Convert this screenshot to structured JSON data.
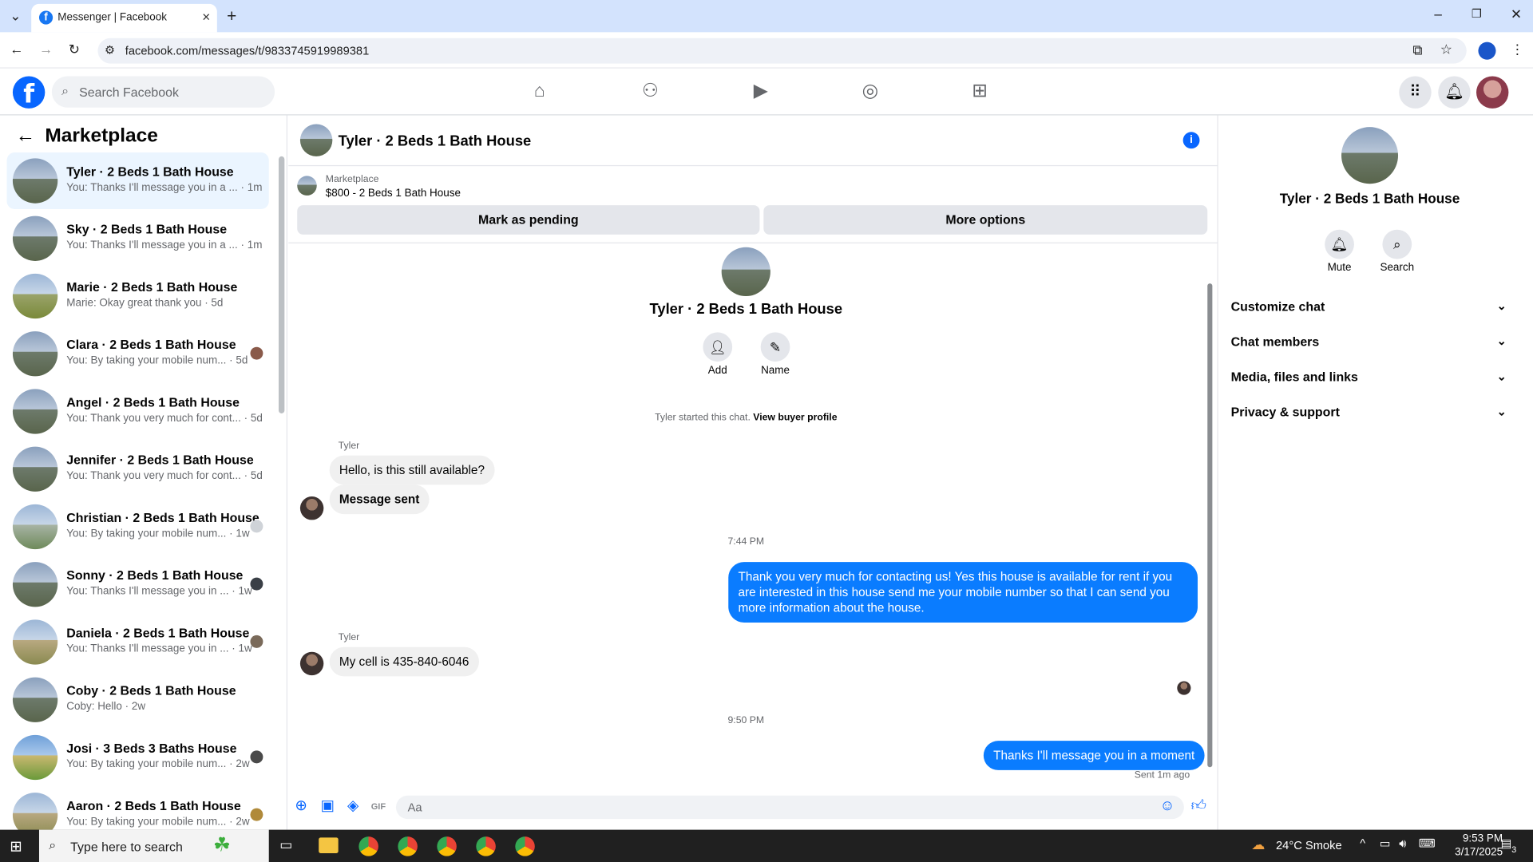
{
  "browser": {
    "tab_title": "Messenger | Facebook",
    "url": "facebook.com/messages/t/9833745919989381"
  },
  "fb": {
    "search_placeholder": "Search Facebook"
  },
  "left_panel": {
    "title": "Marketplace",
    "conversations": [
      {
        "name": "Tyler · 2 Beds 1 Bath House",
        "preview": "You: Thanks I'll message you in a ... · 1m"
      },
      {
        "name": "Sky · 2 Beds 1 Bath House",
        "preview": "You: Thanks I'll message you in a ... · 1m"
      },
      {
        "name": "Marie · 2 Beds 1 Bath House",
        "preview": "Marie: Okay great thank you · 5d"
      },
      {
        "name": "Clara · 2 Beds 1 Bath House",
        "preview": "You: By taking your mobile num... · 5d"
      },
      {
        "name": "Angel · 2 Beds 1 Bath House",
        "preview": "You: Thank you very much for cont... · 5d"
      },
      {
        "name": "Jennifer · 2 Beds 1 Bath House",
        "preview": "You: Thank you very much for cont... · 5d"
      },
      {
        "name": "Christian · 2 Beds 1 Bath House",
        "preview": "You: By taking your mobile num... · 1w"
      },
      {
        "name": "Sonny · 2 Beds 1 Bath House",
        "preview": "You: Thanks I'll message you in ... · 1w"
      },
      {
        "name": "Daniela · 2 Beds 1 Bath House",
        "preview": "You: Thanks I'll message you in ... · 1w"
      },
      {
        "name": "Coby · 2 Beds 1 Bath House",
        "preview": "Coby: Hello · 2w"
      },
      {
        "name": "Josi · 3 Beds 3 Baths House",
        "preview": "You: By taking your mobile num... · 2w"
      },
      {
        "name": "Aaron · 2 Beds 1 Bath House",
        "preview": "You: By taking your mobile num... · 2w"
      }
    ]
  },
  "chat": {
    "title": "Tyler · 2 Beds 1 Bath House",
    "marketplace_label": "Marketplace",
    "listing": "$800 - 2 Beds 1 Bath House",
    "mark_pending": "Mark as pending",
    "more_options": "More options",
    "profile_name": "Tyler · 2 Beds 1 Bath House",
    "add_label": "Add",
    "name_label": "Name",
    "started_text": "Tyler started this chat.",
    "view_profile": "View buyer profile",
    "sender": "Tyler",
    "msg1": "Hello, is this still available?",
    "msg2": "Message sent",
    "time1": "7:44 PM",
    "msg3": "Thank you very much for contacting us! Yes this house is available for rent if you are interested in this house send me your mobile number so that I can send you more information about the house.",
    "msg4": "My cell is 435-840-6046",
    "time2": "9:50 PM",
    "msg5": "Thanks I'll message you in a moment",
    "sent_status": "Sent 1m ago",
    "composer_placeholder": "Aa"
  },
  "right_panel": {
    "name": "Tyler · 2 Beds 1 Bath House",
    "mute": "Mute",
    "search": "Search",
    "sections": [
      "Customize chat",
      "Chat members",
      "Media, files and links",
      "Privacy & support"
    ]
  },
  "taskbar": {
    "search_placeholder": "Type here to search",
    "weather": "24°C  Smoke",
    "time": "9:53 PM",
    "date": "3/17/2025",
    "notif_count": "3"
  }
}
